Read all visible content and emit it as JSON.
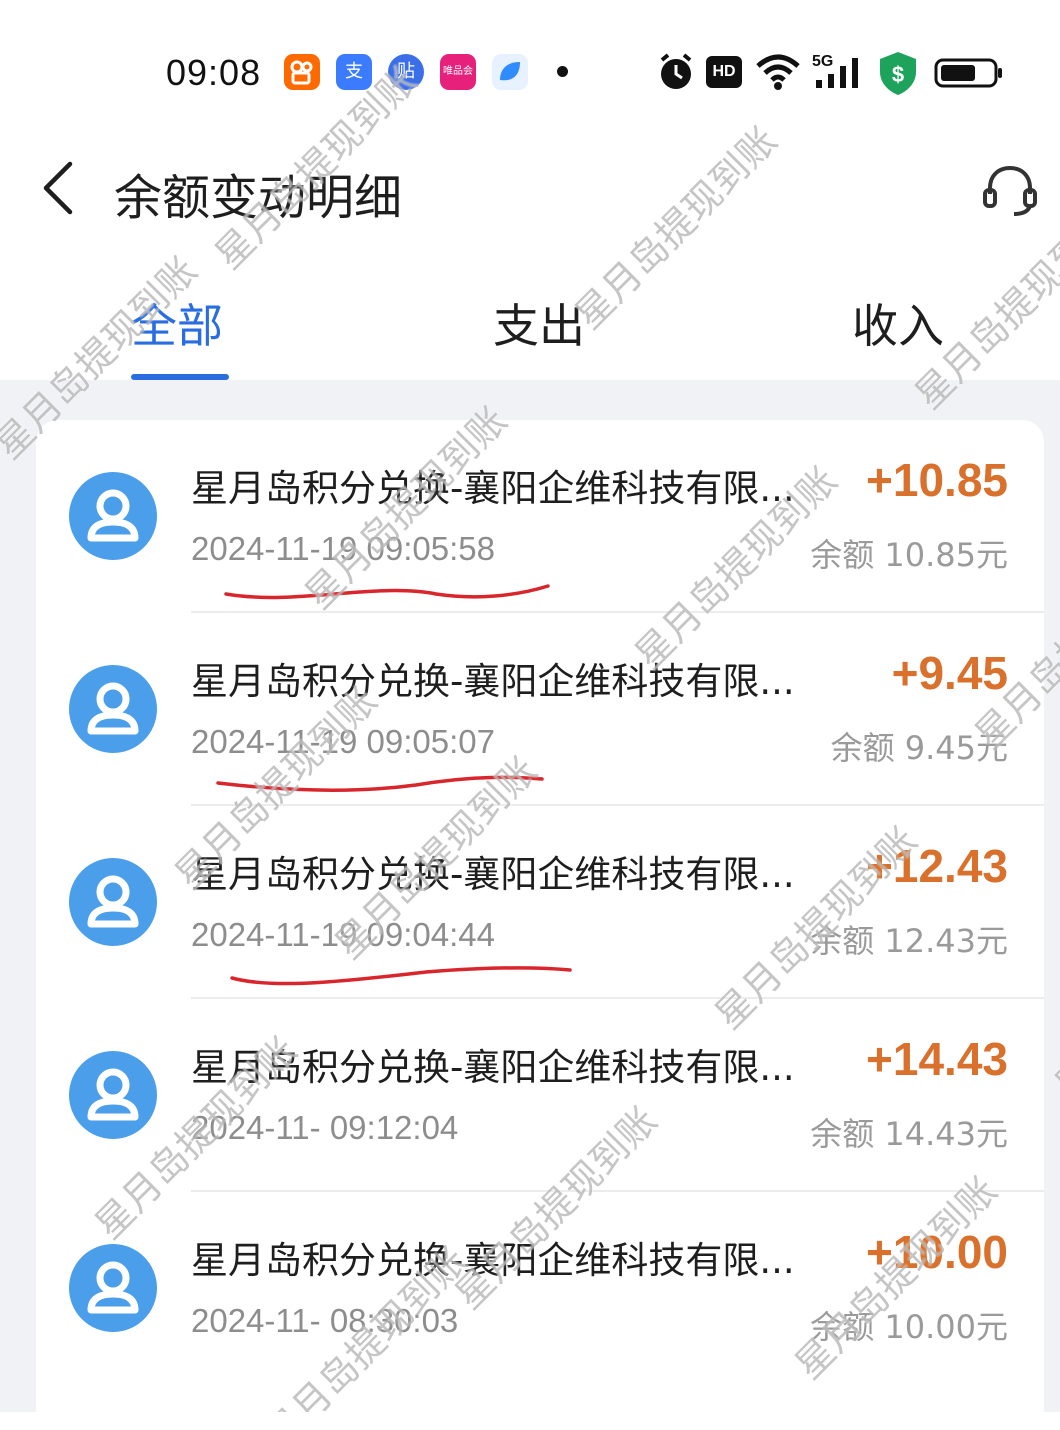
{
  "status_bar": {
    "time": "09:08",
    "app_icons": [
      {
        "name": "kuaishou-icon",
        "glyph": "",
        "color": "#ff6a00"
      },
      {
        "name": "alipay-icon",
        "glyph": "支",
        "color": "#3b7cff"
      },
      {
        "name": "tieba-icon",
        "glyph": "贴",
        "color": "#3c6ee8"
      },
      {
        "name": "vipshop-icon",
        "glyph": "唯品会",
        "color": "#e6207b"
      },
      {
        "name": "blue-app-icon",
        "glyph": "",
        "color": "#2f8cff"
      }
    ],
    "network": "5G",
    "hd_label": "HD",
    "security_glyph": "$"
  },
  "header": {
    "title": "余额变动明细"
  },
  "tabs": [
    {
      "label": "全部",
      "active": true
    },
    {
      "label": "支出",
      "active": false
    },
    {
      "label": "收入",
      "active": false
    }
  ],
  "transactions": [
    {
      "title": "星月岛积分兑换-襄阳企维科技有限...",
      "time": "2024-11-19 09:05:58",
      "amount": "+10.85",
      "balance": "余额 10.85元"
    },
    {
      "title": "星月岛积分兑换-襄阳企维科技有限...",
      "time": "2024-11-19 09:05:07",
      "amount": "+9.45",
      "balance": "余额 9.45元"
    },
    {
      "title": "星月岛积分兑换-襄阳企维科技有限...",
      "time": "2024-11-19 09:04:44",
      "amount": "+12.43",
      "balance": "余额 12.43元"
    },
    {
      "title": "星月岛积分兑换-襄阳企维科技有限...",
      "time": "2024-11-     09:12:04",
      "amount": "+14.43",
      "balance": "余额 14.43元"
    },
    {
      "title": "星月岛积分兑换-襄阳企维科技有限...",
      "time": "2024-11-     08:30:03",
      "amount": "+10.00",
      "balance": "余额 10.00元"
    }
  ],
  "watermark": "星月岛提现到账",
  "colors": {
    "accent": "#2a6de0",
    "amount": "#d9702c",
    "avatar": "#4a9eea",
    "annotation": "#d8262c"
  }
}
